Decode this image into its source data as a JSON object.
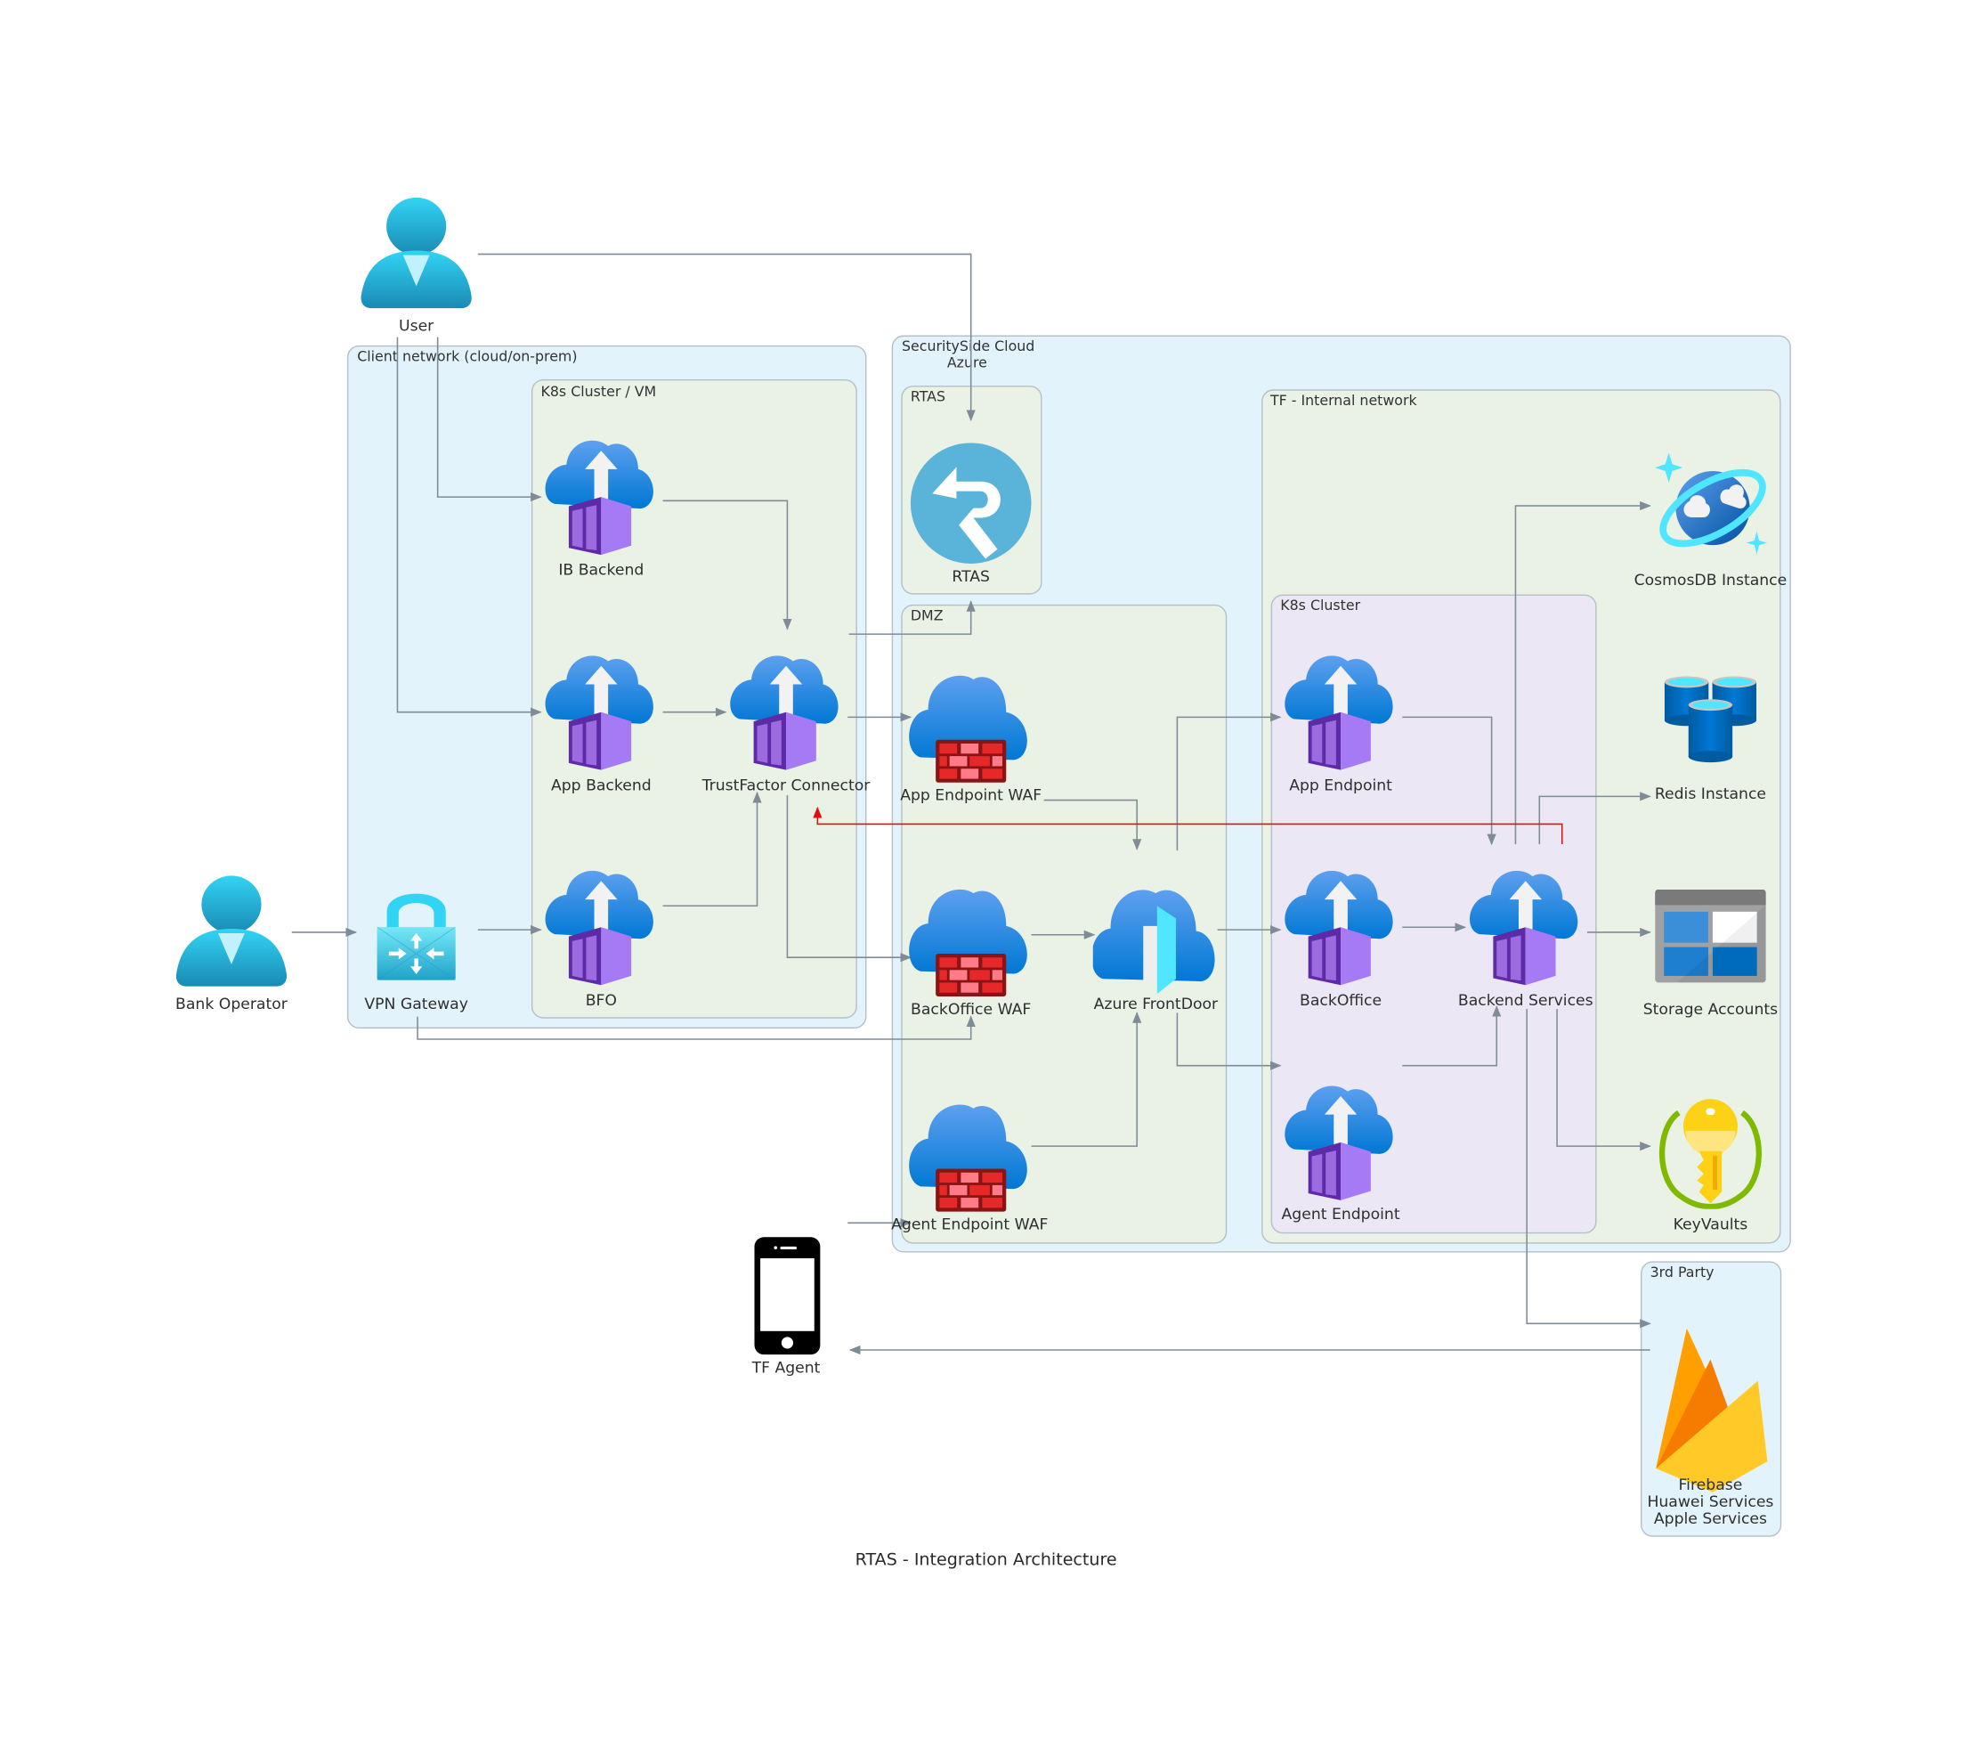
{
  "diagram": {
    "title": "RTAS - Integration Architecture",
    "colors": {
      "cloud_group_fill": "#e3f3fb",
      "network_group_fill": "#eaf2e6",
      "cluster_group_fill": "#ebe7f5",
      "group_border": "#b4c0c8",
      "edge": "#7f8b96",
      "edge_highlight": "#e01010"
    },
    "groups": {
      "client_network": "Client network (cloud/on-prem)",
      "client_k8s": "K8s Cluster / VM",
      "securityside_cloud_line1": "SecuritySide Cloud",
      "securityside_cloud_line2": "Azure",
      "rtas": "RTAS",
      "dmz": "DMZ",
      "tf_internal": "TF - Internal network",
      "tf_k8s": "K8s Cluster",
      "third_party": "3rd Party"
    },
    "nodes": {
      "user": {
        "label": "User",
        "icon": "user-icon"
      },
      "bank_operator": {
        "label": "Bank Operator",
        "icon": "user-icon"
      },
      "vpn_gateway": {
        "label": "VPN Gateway",
        "icon": "vpn-gateway-icon"
      },
      "ib_backend": {
        "label": "IB Backend",
        "icon": "container-app-icon"
      },
      "app_backend": {
        "label": "App Backend",
        "icon": "container-app-icon"
      },
      "bfo": {
        "label": "BFO",
        "icon": "container-app-icon"
      },
      "trustfactor_connector": {
        "label": "TrustFactor Connector",
        "icon": "container-app-icon"
      },
      "rtas": {
        "label": "RTAS",
        "icon": "rtas-logo-icon"
      },
      "app_endpoint_waf": {
        "label": "App Endpoint WAF",
        "icon": "waf-icon"
      },
      "backoffice_waf": {
        "label": "BackOffice WAF",
        "icon": "waf-icon"
      },
      "agent_endpoint_waf": {
        "label": "Agent Endpoint WAF",
        "icon": "waf-icon"
      },
      "azure_frontdoor": {
        "label": "Azure FrontDoor",
        "icon": "frontdoor-icon"
      },
      "app_endpoint": {
        "label": "App Endpoint",
        "icon": "container-app-icon"
      },
      "backoffice": {
        "label": "BackOffice",
        "icon": "container-app-icon"
      },
      "agent_endpoint": {
        "label": "Agent Endpoint",
        "icon": "container-app-icon"
      },
      "backend_services": {
        "label": "Backend Services",
        "icon": "container-app-icon"
      },
      "cosmosdb": {
        "label": "CosmosDB Instance",
        "icon": "cosmosdb-icon"
      },
      "redis": {
        "label": "Redis Instance",
        "icon": "redis-icon"
      },
      "storage": {
        "label": "Storage Accounts",
        "icon": "storage-icon"
      },
      "keyvaults": {
        "label": "KeyVaults",
        "icon": "keyvault-icon"
      },
      "tf_agent": {
        "label": "TF Agent",
        "icon": "mobile-phone-icon"
      },
      "push_services": {
        "label_lines": [
          "Firebase",
          "Huawei Services",
          "Apple Services"
        ],
        "icon": "firebase-icon"
      }
    },
    "edges": [
      {
        "from": "user",
        "to": "rtas"
      },
      {
        "from": "user",
        "to": "ib_backend"
      },
      {
        "from": "user",
        "to": "app_backend"
      },
      {
        "from": "bank_operator",
        "to": "vpn_gateway"
      },
      {
        "from": "vpn_gateway",
        "to": "bfo"
      },
      {
        "from": "vpn_gateway",
        "to": "backoffice_waf"
      },
      {
        "from": "ib_backend",
        "to": "trustfactor_connector"
      },
      {
        "from": "app_backend",
        "to": "trustfactor_connector"
      },
      {
        "from": "bfo",
        "to": "trustfactor_connector"
      },
      {
        "from": "trustfactor_connector",
        "to": "rtas"
      },
      {
        "from": "trustfactor_connector",
        "to": "app_endpoint_waf"
      },
      {
        "from": "trustfactor_connector",
        "to": "backoffice_waf"
      },
      {
        "from": "app_endpoint_waf",
        "to": "azure_frontdoor"
      },
      {
        "from": "backoffice_waf",
        "to": "azure_frontdoor"
      },
      {
        "from": "agent_endpoint_waf",
        "to": "azure_frontdoor"
      },
      {
        "from": "tf_agent",
        "to": "agent_endpoint_waf"
      },
      {
        "from": "azure_frontdoor",
        "to": "app_endpoint"
      },
      {
        "from": "azure_frontdoor",
        "to": "backoffice"
      },
      {
        "from": "azure_frontdoor",
        "to": "agent_endpoint"
      },
      {
        "from": "app_endpoint",
        "to": "backend_services"
      },
      {
        "from": "backoffice",
        "to": "backend_services"
      },
      {
        "from": "agent_endpoint",
        "to": "backend_services"
      },
      {
        "from": "backend_services",
        "to": "cosmosdb"
      },
      {
        "from": "backend_services",
        "to": "redis"
      },
      {
        "from": "backend_services",
        "to": "storage"
      },
      {
        "from": "backend_services",
        "to": "keyvaults"
      },
      {
        "from": "backend_services",
        "to": "push_services"
      },
      {
        "from": "backend_services",
        "to": "trustfactor_connector",
        "highlight": true
      },
      {
        "from": "push_services",
        "to": "tf_agent"
      }
    ]
  }
}
